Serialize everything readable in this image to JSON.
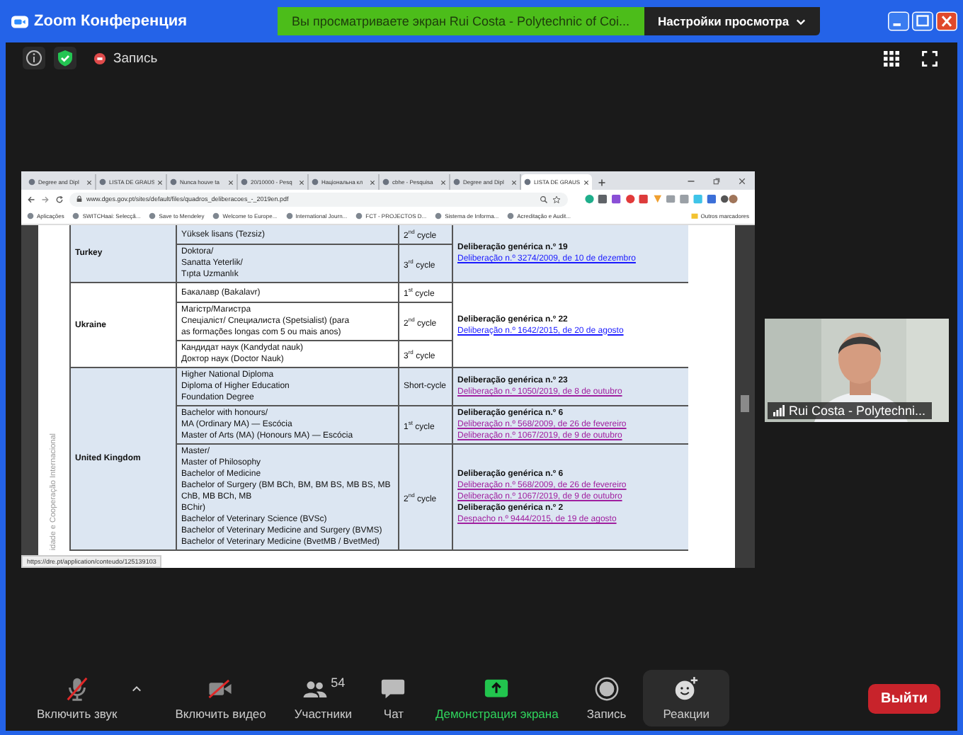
{
  "window": {
    "title": "Zoom Конференция"
  },
  "share_banner": {
    "text": "Вы просматриваете экран Rui Costa - Polytechnic of Coi...",
    "view_options": "Настройки просмотра"
  },
  "top_bar": {
    "recording": "Запись"
  },
  "shared_screen": {
    "tabs": [
      {
        "label": "Degree and Dipl",
        "selected": false
      },
      {
        "label": "LISTA DE GRAUS",
        "selected": false
      },
      {
        "label": "Nunca houve ta",
        "selected": false
      },
      {
        "label": "20/10000 - Pesq",
        "selected": false
      },
      {
        "label": "Національна кл",
        "selected": false
      },
      {
        "label": "cbhe - Pesquisa",
        "selected": false
      },
      {
        "label": "Degree and Dipl",
        "selected": false
      },
      {
        "label": "LISTA DE GRAUS",
        "selected": true
      }
    ],
    "url": "www.dges.gov.pt/sites/default/files/quadros_deliberacoes_-_2019en.pdf",
    "bookmarks": [
      "Aplicações",
      "SWITCHaai: Selecçã...",
      "Save to Mendeley",
      "Welcome to Europe...",
      "International Journ...",
      "FCT - PROJECTOS D...",
      "Sistema de Informa...",
      "Acreditação e Audit..."
    ],
    "other_bookmarks": "Outros marcadores",
    "side_text": "idade e Cooperação Internacional",
    "groups": [
      {
        "country": "Turkey",
        "shaded": true,
        "rows": [
          {
            "qualification": "Yüksek lisans (Tezsiz)",
            "cycle": "2$^{nd}$ cycle"
          },
          {
            "qualification": "Doktora/\nSanatta Yeterlik/\nTıpta Uzmanlık",
            "cycle": "3$^{rd}$ cycle"
          }
        ],
        "deliberations": [
          {
            "kind": "heading",
            "text": "Deliberação genérica n.º 19"
          },
          {
            "kind": "link",
            "text": "Deliberação n.º 3274/2009, de 10 de dezembro",
            "visited": false
          }
        ]
      },
      {
        "country": "Ukraine",
        "shaded": false,
        "rows": [
          {
            "qualification": "Бакалавр (Bakalavr)",
            "cycle": "1$^{st}$ cycle"
          },
          {
            "qualification": "Магістр/Магистра\nСпеціаліст/ Специалиста (Spetsialist) (para\nas formações longas com 5 ou mais anos)",
            "cycle": "2$^{nd}$ cycle"
          },
          {
            "qualification": "Кандидат наук (Kandydat nauk)\nДоктор наук (Doctor Nauk)",
            "cycle": "3$^{rd}$ cycle"
          }
        ],
        "deliberations": [
          {
            "kind": "heading",
            "text": "Deliberação genérica n.º 22"
          },
          {
            "kind": "link",
            "text": "Deliberação n.º 1642/2015, de 20 de agosto",
            "visited": false
          }
        ]
      },
      {
        "country": "United Kingdom",
        "shaded": true,
        "rows": [
          {
            "qualification": "Higher National Diploma\nDiploma of Higher Education\nFoundation Degree",
            "cycle": "Short-cycle",
            "deliberations": [
              {
                "kind": "heading",
                "text": "Deliberação genérica n.º 23"
              },
              {
                "kind": "link",
                "text": "Deliberação n.º 1050/2019, de 8 de outubro",
                "visited": true
              }
            ]
          },
          {
            "qualification": "Bachelor with honours/\nMA (Ordinary MA) — Escócia\nMaster of Arts (MA) (Honours MA) — Escócia",
            "cycle": "1$^{st}$ cycle",
            "deliberations": [
              {
                "kind": "heading",
                "text": "Deliberação genérica n.º 6"
              },
              {
                "kind": "link",
                "text": "Deliberação n.º 568/2009, de 26 de fevereiro",
                "visited": true
              },
              {
                "kind": "link",
                "text": "Deliberação n.º 1067/2019, de 9 de outubro",
                "visited": true
              }
            ]
          },
          {
            "qualification": "Master/\nMaster of Philosophy\nBachelor of Medicine\nBachelor of Surgery (BM BCh, BM, BM BS, MB BS, MB\nChB, MB BCh, MB\nBChir)\nBachelor of Veterinary Science (BVSc)\nBachelor of Veterinary Medicine and Surgery (BVMS)\nBachelor of Veterinary Medicine (BvetMB / BvetMed)",
            "cycle": "2$^{nd}$ cycle",
            "deliberations": [
              {
                "kind": "heading",
                "text": "Deliberação genérica n.º 6"
              },
              {
                "kind": "link",
                "text": "Deliberação n.º 568/2009, de 26 de fevereiro",
                "visited": true
              },
              {
                "kind": "link",
                "text": "Deliberação n.º 1067/2019, de 9 de outubro",
                "visited": true
              },
              {
                "kind": "heading",
                "text": "Deliberação genérica n.º 2"
              },
              {
                "kind": "link",
                "text": "Despacho n.º 9444/2015, de 19 de agosto",
                "visited": true
              }
            ]
          }
        ]
      }
    ],
    "status_url": "https://dre.pt/application/conteudo/125139103"
  },
  "participant": {
    "name": "Rui Costa - Polytechni..."
  },
  "toolbar": {
    "items": [
      {
        "kind": "mic",
        "label": "Включить звук",
        "muted": true,
        "highlighted": false
      },
      {
        "kind": "video",
        "label": "Включить видео",
        "muted": true,
        "highlighted": false
      },
      {
        "kind": "participants",
        "label": "Участники",
        "count": "54",
        "highlighted": false
      },
      {
        "kind": "chat",
        "label": "Чат",
        "highlighted": false
      },
      {
        "kind": "share",
        "label": "Демонстрация экрана",
        "highlighted": false
      },
      {
        "kind": "record",
        "label": "Запись",
        "highlighted": false
      },
      {
        "kind": "reactions",
        "label": "Реакции",
        "highlighted": true
      }
    ],
    "leave": "Выйти"
  }
}
